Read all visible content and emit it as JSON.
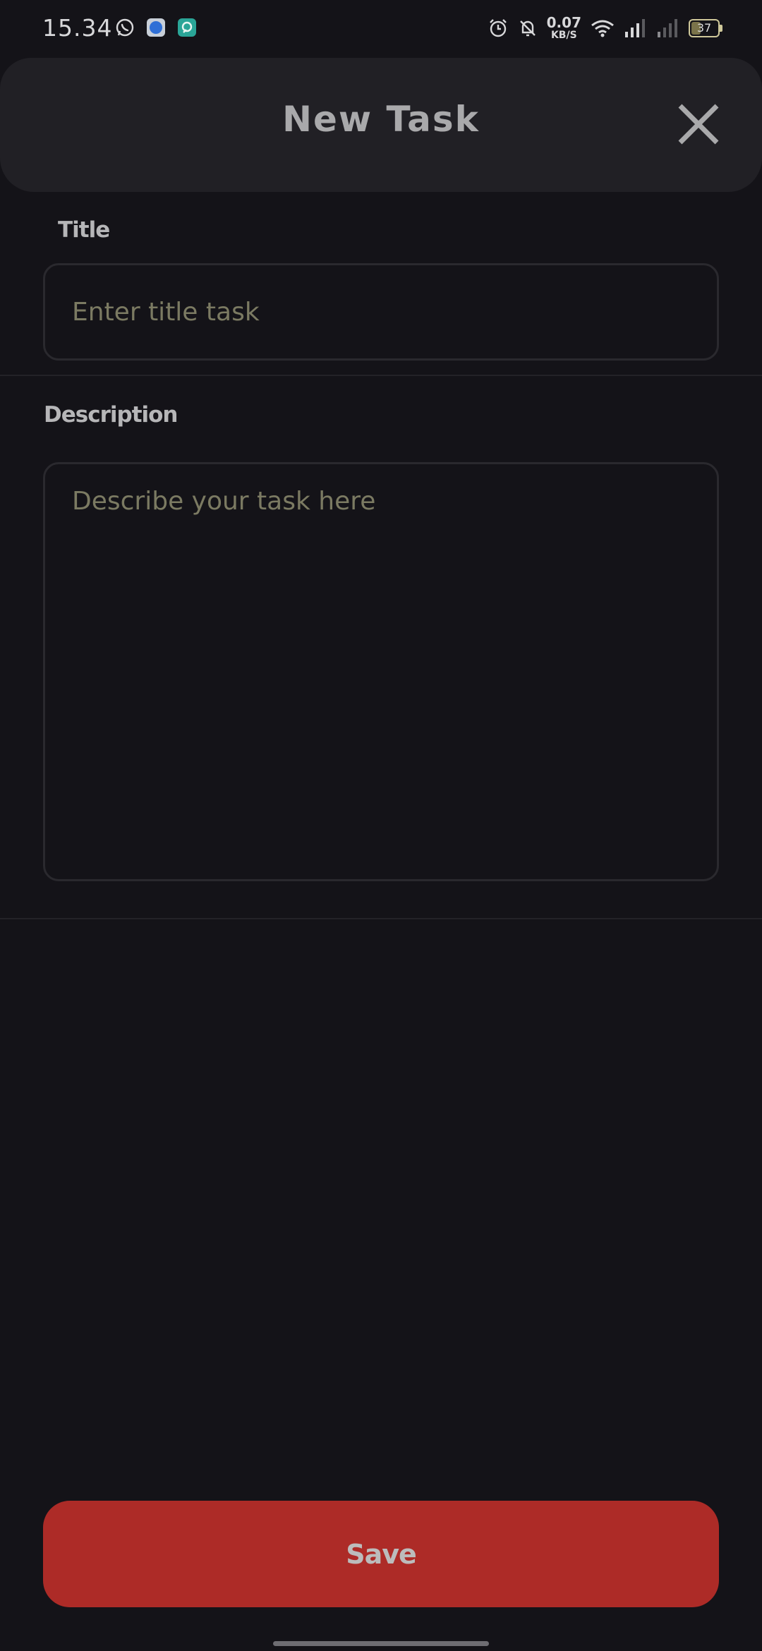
{
  "status_bar": {
    "time": "15.34",
    "net_speed_value": "0.07",
    "net_speed_unit": "KB/S",
    "battery": "37",
    "battery_level": 0.37,
    "notification_icons": [
      "whatsapp-icon",
      "app-blue-icon",
      "app-teal-icon"
    ],
    "right_icons": [
      "alarm-icon",
      "bell-off-icon",
      "wifi-icon",
      "signal-icon",
      "signal-icon-2",
      "battery-icon"
    ]
  },
  "header": {
    "title": "New Task",
    "close_icon": "close-icon"
  },
  "form": {
    "title_label": "Title",
    "title_placeholder": "Enter title task",
    "title_value": "",
    "description_label": "Description",
    "description_placeholder": "Describe your task here",
    "description_value": ""
  },
  "actions": {
    "save_label": "Save"
  },
  "colors": {
    "background": "#141318",
    "header": "#212025",
    "accent_save": "#ad2b27",
    "placeholder": "#7b7a62"
  }
}
